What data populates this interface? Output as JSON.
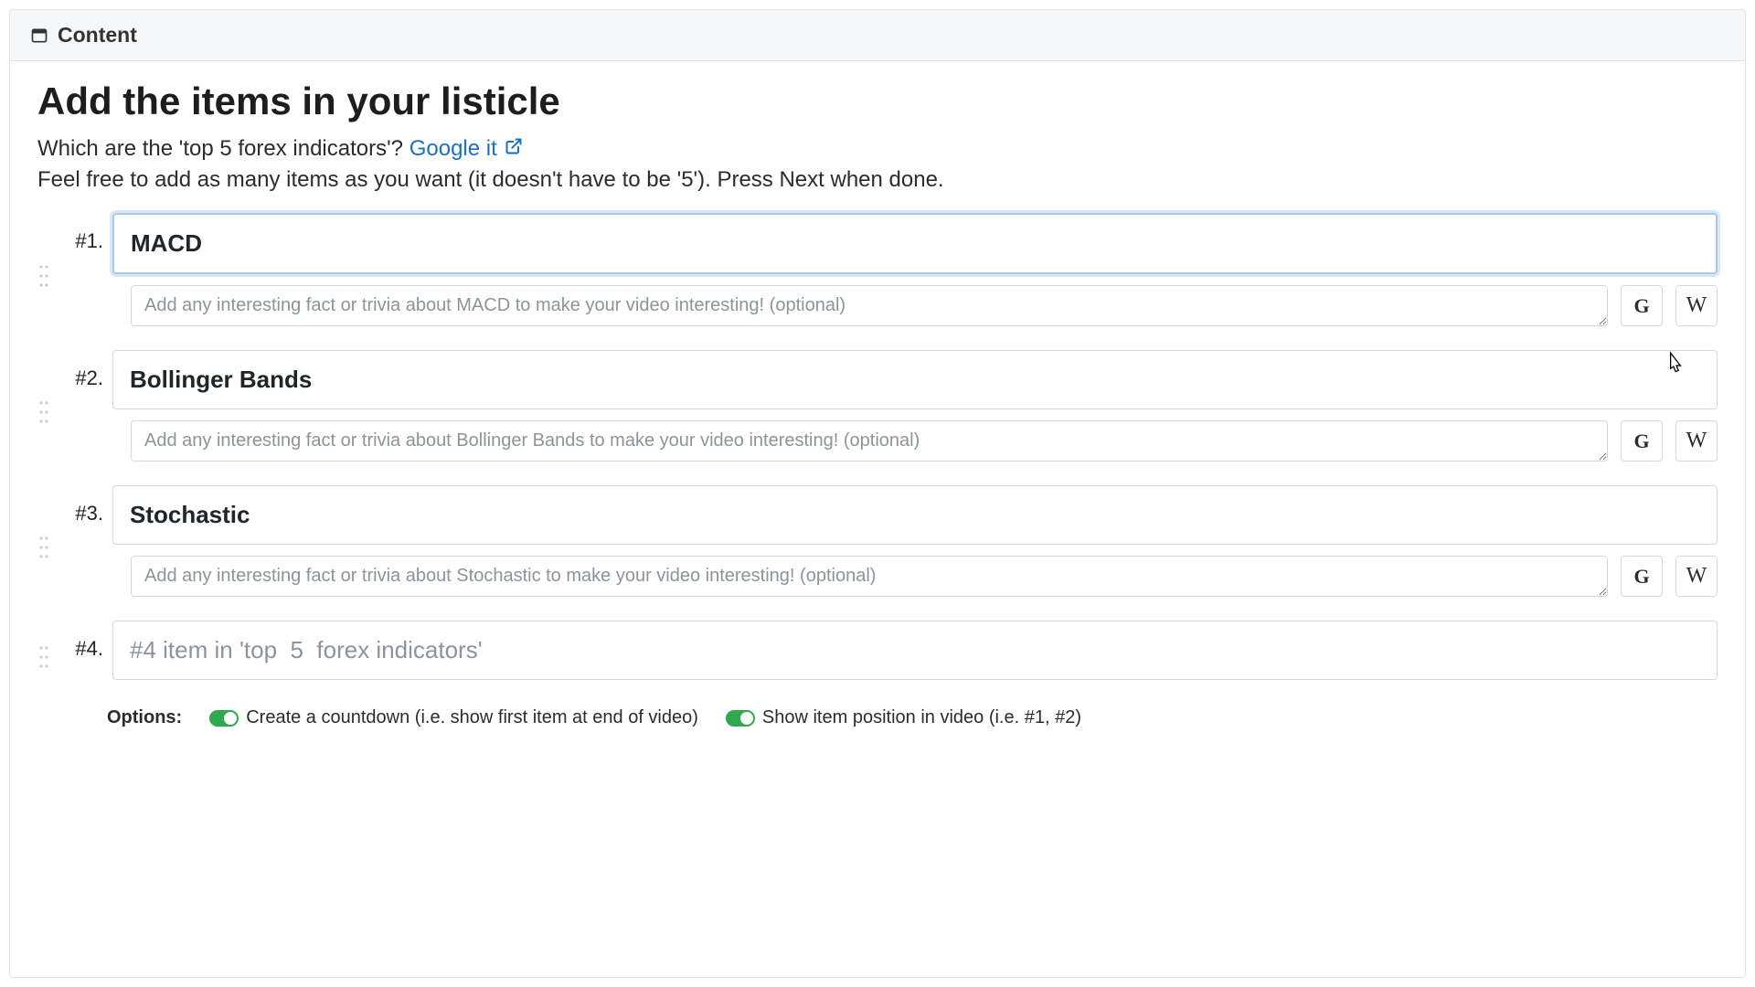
{
  "header": {
    "title": "Content"
  },
  "page": {
    "title": "Add the items in your listicle",
    "question": "Which are the 'top 5 forex indicators'?",
    "google_link_text": "Google it",
    "hint": "Feel free to add as many items as you want (it doesn't have to be '5'). Press Next when done."
  },
  "items": [
    {
      "num": "#1.",
      "title": "MACD",
      "trivia_placeholder": "Add any interesting fact or trivia about MACD to make your video interesting! (optional)",
      "focused": true,
      "show_trivia": true
    },
    {
      "num": "#2.",
      "title": "Bollinger Bands",
      "trivia_placeholder": "Add any interesting fact or trivia about Bollinger Bands to make your video interesting! (optional)",
      "focused": false,
      "show_trivia": true
    },
    {
      "num": "#3.",
      "title": "Stochastic",
      "trivia_placeholder": "Add any interesting fact or trivia about Stochastic to make your video interesting! (optional)",
      "focused": false,
      "show_trivia": true
    },
    {
      "num": "#4.",
      "title": "",
      "title_placeholder": "#4 item in 'top  5  forex indicators'",
      "show_trivia": false
    }
  ],
  "options": {
    "label": "Options:",
    "countdown": "Create a countdown (i.e. show first item at end of video)",
    "show_position": "Show item position in video (i.e. #1, #2)"
  },
  "icons": {
    "google_letter": "G",
    "wiki_letter": "W"
  }
}
